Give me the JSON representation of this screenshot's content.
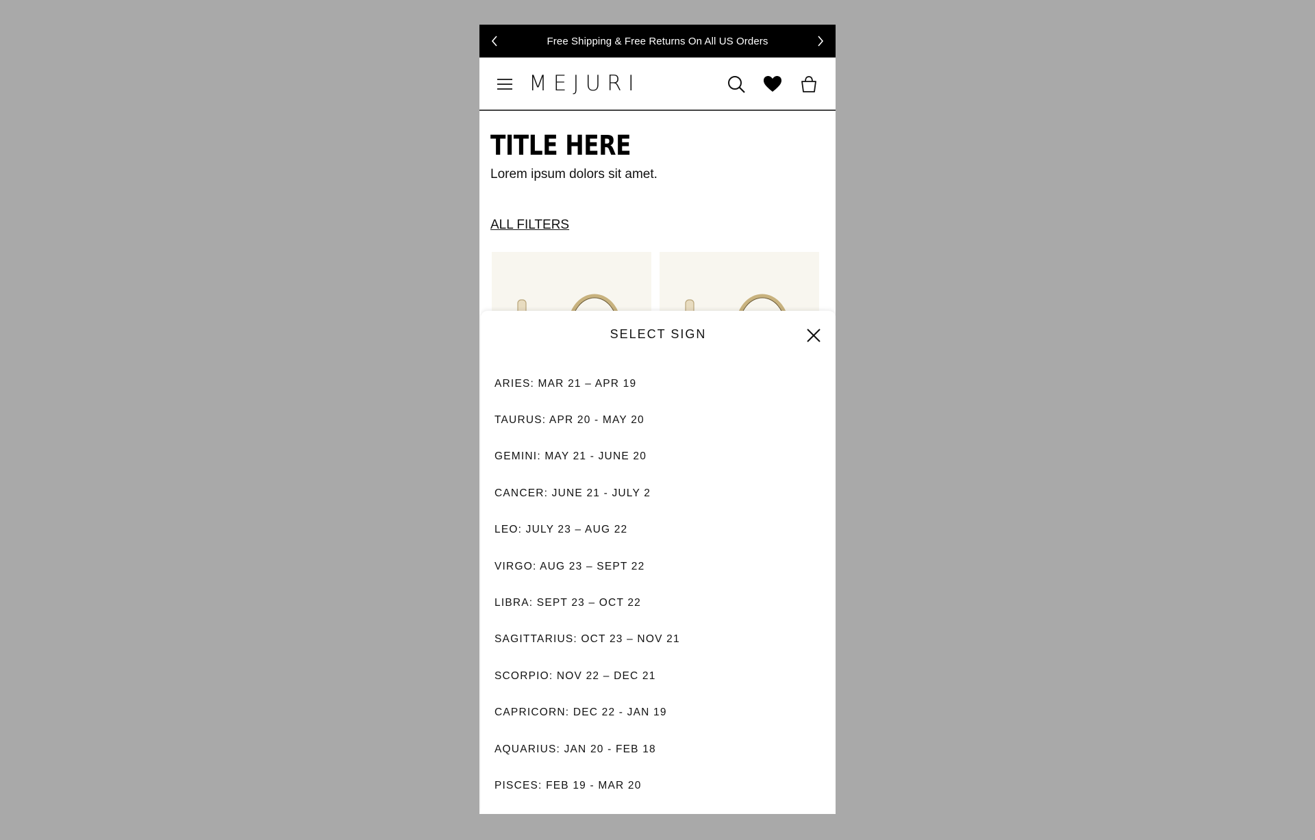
{
  "promo": {
    "text": "Free Shipping & Free Returns On All US Orders",
    "prev_icon": "chevron-left-icon",
    "next_icon": "chevron-right-icon"
  },
  "header": {
    "logo": "MEJURI",
    "icons": [
      "menu-icon",
      "search-icon",
      "heart-icon",
      "bag-icon"
    ]
  },
  "page": {
    "title": "TITLE HERE",
    "subtitle": "Lorem ipsum dolors sit amet.",
    "filters_label": "ALL FILTERS"
  },
  "sheet": {
    "title": "SELECT SIGN",
    "close_icon": "close-icon",
    "signs": [
      "ARIES: MAR 21 – APR 19",
      "TAURUS: APR 20 - MAY 20",
      "GEMINI: MAY 21 - JUNE 20",
      "CANCER: JUNE 21 - JULY 2",
      "LEO: JULY 23 – AUG 22",
      "VIRGO: AUG 23 – SEPT 22",
      "LIBRA: SEPT 23 – OCT 22",
      "SAGITTARIUS: OCT 23 – NOV 21",
      "SCORPIO: NOV 22 – DEC 21",
      "CAPRICORN: DEC 22 - JAN 19",
      "AQUARIUS: JAN 20 - FEB 18",
      "PISCES: FEB 19 - MAR 20"
    ]
  },
  "colors": {
    "background": "#a9a9a9",
    "promo_bar": "#000000",
    "product_bg": "#f8f6ef"
  }
}
